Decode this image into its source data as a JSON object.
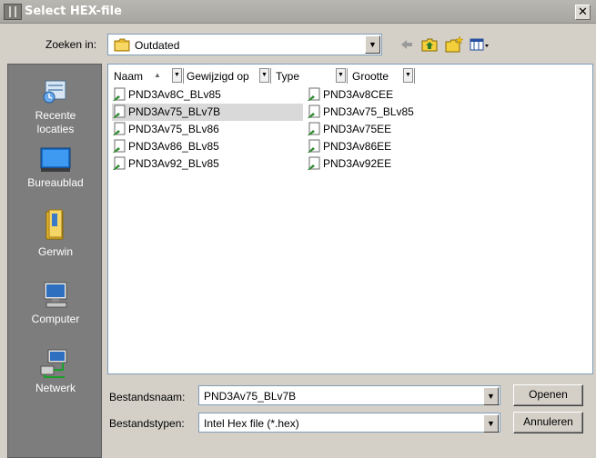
{
  "window": {
    "title": "Select HEX-file"
  },
  "lookin": {
    "label": "Zoeken in:",
    "value": "Outdated"
  },
  "places": [
    {
      "label_1": "Recente",
      "label_2": "locaties"
    },
    {
      "label_1": "Bureaublad"
    },
    {
      "label_1": "Gerwin"
    },
    {
      "label_1": "Computer"
    },
    {
      "label_1": "Netwerk"
    }
  ],
  "columns": [
    {
      "label": "Naam",
      "sort_glyph": "▲"
    },
    {
      "label": "Gewijzigd op"
    },
    {
      "label": "Type"
    },
    {
      "label": "Grootte"
    }
  ],
  "files": [
    {
      "name": "PND3Av8C_BLv85"
    },
    {
      "name": "PND3Av75_BLv7B",
      "selected": true
    },
    {
      "name": "PND3Av75_BLv86"
    },
    {
      "name": "PND3Av86_BLv85"
    },
    {
      "name": "PND3Av92_BLv85"
    },
    {
      "name": "PND3Av8CEE"
    },
    {
      "name": "PND3Av75_BLv85"
    },
    {
      "name": "PND3Av75EE"
    },
    {
      "name": "PND3Av86EE"
    },
    {
      "name": "PND3Av92EE"
    }
  ],
  "filename": {
    "label": "Bestandsnaam:",
    "value": "PND3Av75_BLv7B"
  },
  "filetype": {
    "label": "Bestandstypen:",
    "value": "Intel Hex file (*.hex)"
  },
  "buttons": {
    "open": "Openen",
    "cancel": "Annuleren"
  },
  "icons": {
    "combo_arrow": "▼",
    "close": "✕",
    "back": "back-arrow-icon",
    "up": "up-folder-icon",
    "new_folder": "new-folder-icon",
    "view": "view-menu-icon"
  }
}
